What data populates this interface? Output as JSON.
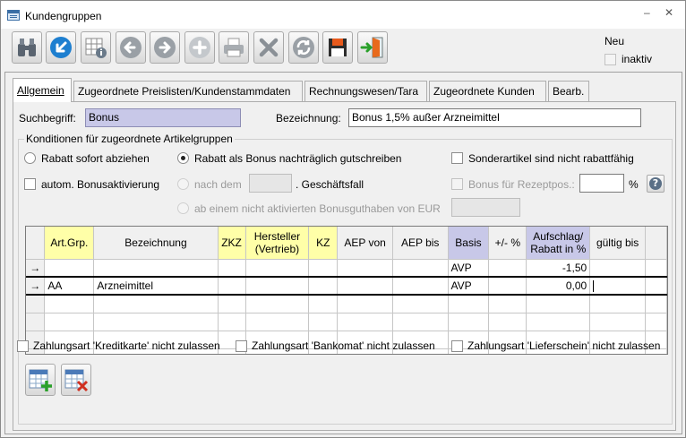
{
  "window": {
    "title": "Kundengruppen",
    "minimize_glyph": "–",
    "close_glyph": "✕"
  },
  "toolbar": {
    "buttons": [
      {
        "icon": "binoculars-icon"
      },
      {
        "icon": "undo-arrow-icon"
      },
      {
        "icon": "grid-info-icon"
      },
      {
        "icon": "arrow-left-icon"
      },
      {
        "icon": "arrow-right-icon"
      },
      {
        "icon": "plus-icon"
      },
      {
        "icon": "printer-icon"
      },
      {
        "icon": "delete-x-icon"
      },
      {
        "icon": "refresh-icon"
      },
      {
        "icon": "save-disk-icon"
      },
      {
        "icon": "exit-door-icon"
      }
    ]
  },
  "status": {
    "neu_label": "Neu",
    "inaktiv_label": "inaktiv",
    "inaktiv_checked": false
  },
  "tabs": [
    {
      "label": "Allgemein",
      "active": true
    },
    {
      "label": "Zugeordnete Preislisten/Kundenstammdaten",
      "active": false
    },
    {
      "label": "Rechnungswesen/Tara",
      "active": false
    },
    {
      "label": "Zugeordnete Kunden",
      "active": false
    },
    {
      "label": "Bearb.",
      "active": false
    }
  ],
  "form": {
    "suchbegriff_label": "Suchbegriff:",
    "suchbegriff_value": "Bonus",
    "bezeichnung_label": "Bezeichnung:",
    "bezeichnung_value": "Bonus 1,5% außer Arzneimittel"
  },
  "conditions": {
    "group_title": "Konditionen für zugeordnete Artikelgruppen",
    "radio_sofort": "Rabatt sofort abziehen",
    "radio_bonus": "Rabatt als Bonus nachträglich gutschreiben",
    "sonderartikel": "Sonderartikel sind nicht rabattfähig",
    "auto_bonus": "autom. Bonusaktivierung",
    "nach_dem": "nach dem",
    "geschaeftsfall": ". Geschäftsfall",
    "bonus_rezept": "Bonus für Rezeptpos.:",
    "percent": "%",
    "help": "?",
    "ab_einem": "ab einem nicht aktivierten Bonusguthaben von EUR",
    "nach_dem_value": "",
    "bonus_rezept_value": "",
    "ab_einem_value": ""
  },
  "grid": {
    "columns": [
      "Art.Grp.",
      "Bezeichnung",
      "ZKZ",
      "Hersteller (Vertrieb)",
      "KZ",
      "AEP von",
      "AEP bis",
      "Basis",
      "+/- %",
      "Aufschlag/ Rabatt in %",
      "gültig bis"
    ],
    "rows": [
      {
        "indicator": "→",
        "art_grp": "",
        "bezeichnung": "",
        "zkz": "",
        "hersteller": "",
        "kz": "",
        "aep_von": "",
        "aep_bis": "",
        "basis": "AVP",
        "plusminus": "",
        "aufschlag": "-1,50",
        "gueltig_bis": ""
      },
      {
        "indicator": "→",
        "art_grp": "AA",
        "bezeichnung": "Arzneimittel",
        "zkz": "",
        "hersteller": "",
        "kz": "",
        "aep_von": "",
        "aep_bis": "",
        "basis": "AVP",
        "plusminus": "",
        "aufschlag": "0,00",
        "gueltig_bis": ""
      }
    ]
  },
  "options": {
    "kreditkarte": "Zahlungsart 'Kreditkarte' nicht zulassen",
    "bankomat": "Zahlungsart 'Bankomat' nicht zulassen",
    "lieferschein": "Zahlungsart 'Lieferschein' nicht zulassen"
  }
}
